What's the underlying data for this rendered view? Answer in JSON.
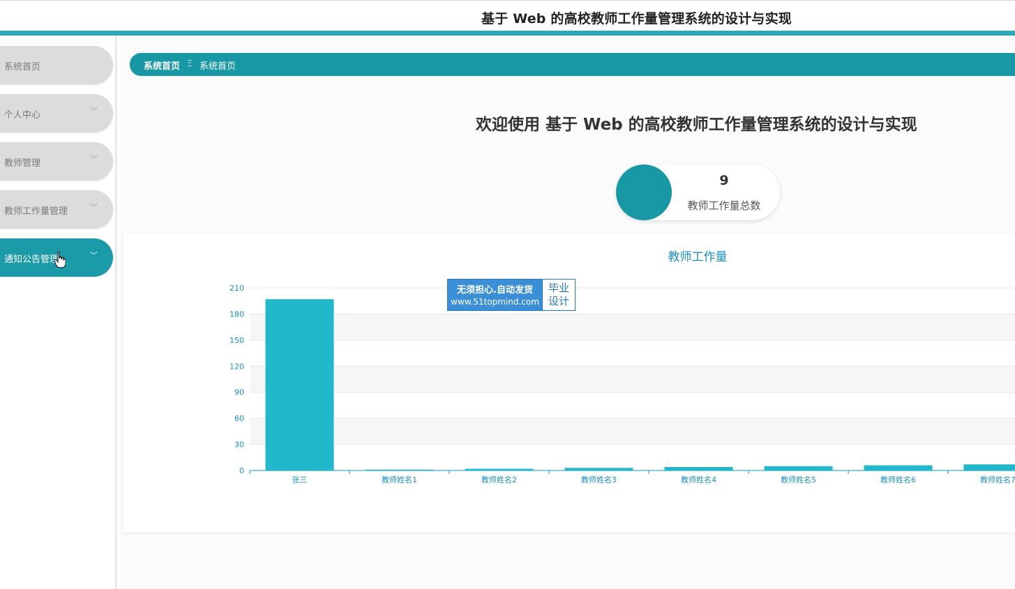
{
  "app": {
    "title": "基于 Web 的高校教师工作量管理系统的设计与实现"
  },
  "sidebar": {
    "items": [
      {
        "label": "系统首页",
        "has_submenu": false,
        "active": false
      },
      {
        "label": "个人中心",
        "has_submenu": true,
        "active": false
      },
      {
        "label": "教师管理",
        "has_submenu": true,
        "active": false
      },
      {
        "label": "教师工作量管理",
        "has_submenu": true,
        "active": false
      },
      {
        "label": "通知公告管理",
        "has_submenu": true,
        "active": true
      }
    ],
    "chevron_icon": "chevron-down-icon"
  },
  "breadcrumb": {
    "home": "系统首页",
    "separator": "Ξ",
    "current": "系统首页"
  },
  "welcome": {
    "text": "欢迎使用 基于 Web 的高校教师工作量管理系统的设计与实现"
  },
  "stat": {
    "value": "9",
    "label": "教师工作量总数"
  },
  "watermark": {
    "line1": "无须担心.自动发货",
    "line2": "www.51topmind.com",
    "right_line1": "毕业",
    "right_line2": "设计"
  },
  "colors": {
    "accent": "#1897a5",
    "bar": "#22b8cb",
    "axis_text": "#1a8fbf"
  },
  "chart_data": {
    "type": "bar",
    "title": "教师工作量",
    "categories": [
      "张三",
      "教师姓名1",
      "教师姓名2",
      "教师姓名3",
      "教师姓名4",
      "教师姓名5",
      "教师姓名6",
      "教师姓名7"
    ],
    "values": [
      197,
      1,
      2,
      3,
      4,
      5,
      6,
      7
    ],
    "ylim": [
      0,
      210
    ],
    "yticks": [
      0,
      30,
      60,
      90,
      120,
      150,
      180,
      210
    ],
    "xlabel": "",
    "ylabel": "",
    "grid": true
  }
}
